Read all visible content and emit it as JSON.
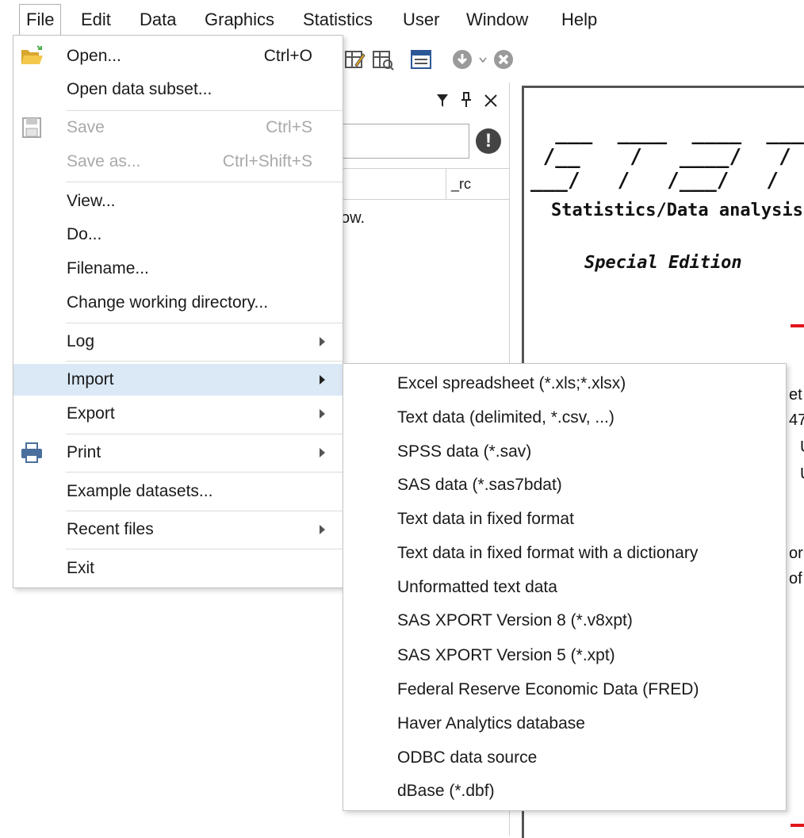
{
  "menubar": {
    "items": [
      "File",
      "Edit",
      "Data",
      "Graphics",
      "Statistics",
      "User",
      "Window",
      "Help"
    ]
  },
  "variables_pane": {
    "column_header": "_rc",
    "message_fragment": "ow."
  },
  "results": {
    "logo_ascii": "  ___  ____  ____  ____  _\n /__    /   ____/   /   _\n___/   /   /___/   /   /_",
    "tagline": "Statistics/Data analysis",
    "edition": "Special Edition",
    "fragments": [
      "et",
      "47",
      "U",
      "U",
      "or",
      "of"
    ],
    "accent_color": "#e0161b"
  },
  "file_menu": {
    "open": {
      "label": "Open...",
      "shortcut": "Ctrl+O"
    },
    "open_subset": {
      "label": "Open data subset..."
    },
    "save": {
      "label": "Save",
      "shortcut": "Ctrl+S"
    },
    "save_as": {
      "label": "Save as...",
      "shortcut": "Ctrl+Shift+S"
    },
    "view": {
      "label": "View..."
    },
    "do": {
      "label": "Do..."
    },
    "filename": {
      "label": "Filename..."
    },
    "change_dir": {
      "label": "Change working directory..."
    },
    "log": {
      "label": "Log"
    },
    "import": {
      "label": "Import"
    },
    "export": {
      "label": "Export"
    },
    "print": {
      "label": "Print"
    },
    "examples": {
      "label": "Example datasets..."
    },
    "recent": {
      "label": "Recent files"
    },
    "exit": {
      "label": "Exit"
    },
    "highlight_color": "#dbe8f5"
  },
  "import_menu": {
    "items": [
      "Excel spreadsheet (*.xls;*.xlsx)",
      "Text data (delimited, *.csv, ...)",
      "SPSS data (*.sav)",
      "SAS data (*.sas7bdat)",
      "Text data in fixed format",
      "Text data in fixed format with a dictionary",
      "Unformatted text data",
      "SAS XPORT Version 8 (*.v8xpt)",
      "SAS XPORT Version 5 (*.xpt)",
      "Federal Reserve Economic Data (FRED)",
      "Haver Analytics database",
      "ODBC data source",
      "dBase (*.dbf)"
    ]
  }
}
